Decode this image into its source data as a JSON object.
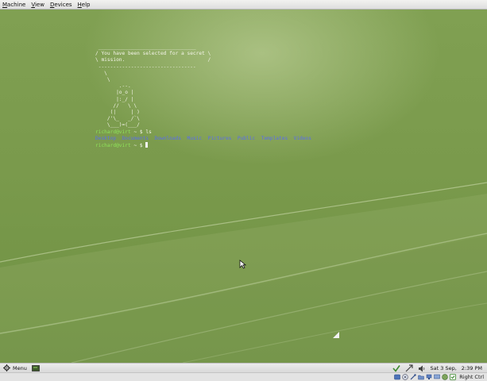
{
  "menubar": {
    "items": [
      "Machine",
      "View",
      "Devices",
      "Help"
    ]
  },
  "terminal": {
    "cowsay_lines": [
      " _________________________________",
      "/ You have been selected for a secret \\",
      "\\ mission.                            /",
      " ---------------------------------",
      "   \\",
      "    \\",
      "        .--.",
      "       |o_o |",
      "       |:_/ |",
      "      //   \\ \\",
      "     (|     | )",
      "    /'\\_   _/`\\",
      "    \\___)=(___/"
    ],
    "prompt_user": "richard@virt",
    "prompt_path": " ~ $ ",
    "command": "ls",
    "dirs": [
      "Desktop",
      "Documents",
      "Downloads",
      "Music",
      "Pictures",
      "Public",
      "Templates",
      "Videos"
    ]
  },
  "panel": {
    "menu_label": "Menu",
    "clock_date": "Sat  3 Sep,",
    "clock_time": "2:39 PM"
  },
  "statusbar": {
    "host_key": "Right Ctrl"
  },
  "colors": {
    "prompt_user": "#8fe35a",
    "directory": "#5a6cf0",
    "desktop": "#7a9a4c"
  }
}
